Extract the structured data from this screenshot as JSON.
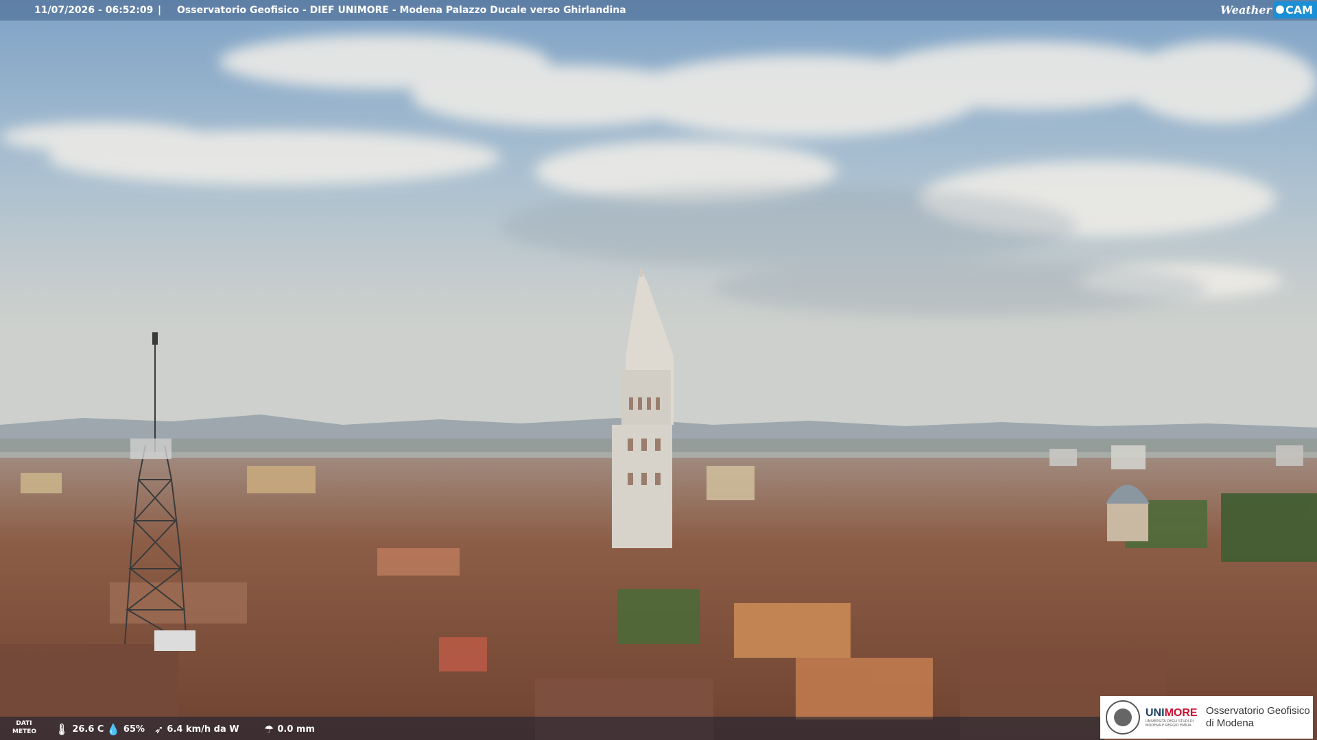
{
  "overlay": {
    "timestamp": "11/07/2026 - 06:52:09",
    "separator": "|",
    "title": "Osservatorio Geofisico - DIEF UNIMORE - Modena Palazzo Ducale verso Ghirlandina",
    "logo_weather": "Weather",
    "logo_cam": "CAM"
  },
  "meteo": {
    "label_line1": "DATI",
    "label_line2": "METEO",
    "temperature": "26.6 C",
    "humidity": "65%",
    "wind": "6.4 km/h da W",
    "rain": "0.0 mm",
    "icons": [
      "thermometer-icon",
      "humidity-drop-icon",
      "wind-icon",
      "rain-icon"
    ]
  },
  "branding": {
    "uni_part1": "UNI",
    "uni_part2": "MORE",
    "uni_sub": "UNIVERSITÀ DEGLI STUDI DI MODENA E REGGIO EMILIA",
    "obs_line1": "Osservatorio Geofisico",
    "obs_line2": "di Modena"
  },
  "colors": {
    "sky_top": "#7fa3c8",
    "sky_horizon": "#c9cfcf",
    "roofs": "#8a5a44",
    "tower": "#d9d6cf",
    "accent_blue": "#1a8fd6",
    "unimore_red": "#c8102e"
  }
}
